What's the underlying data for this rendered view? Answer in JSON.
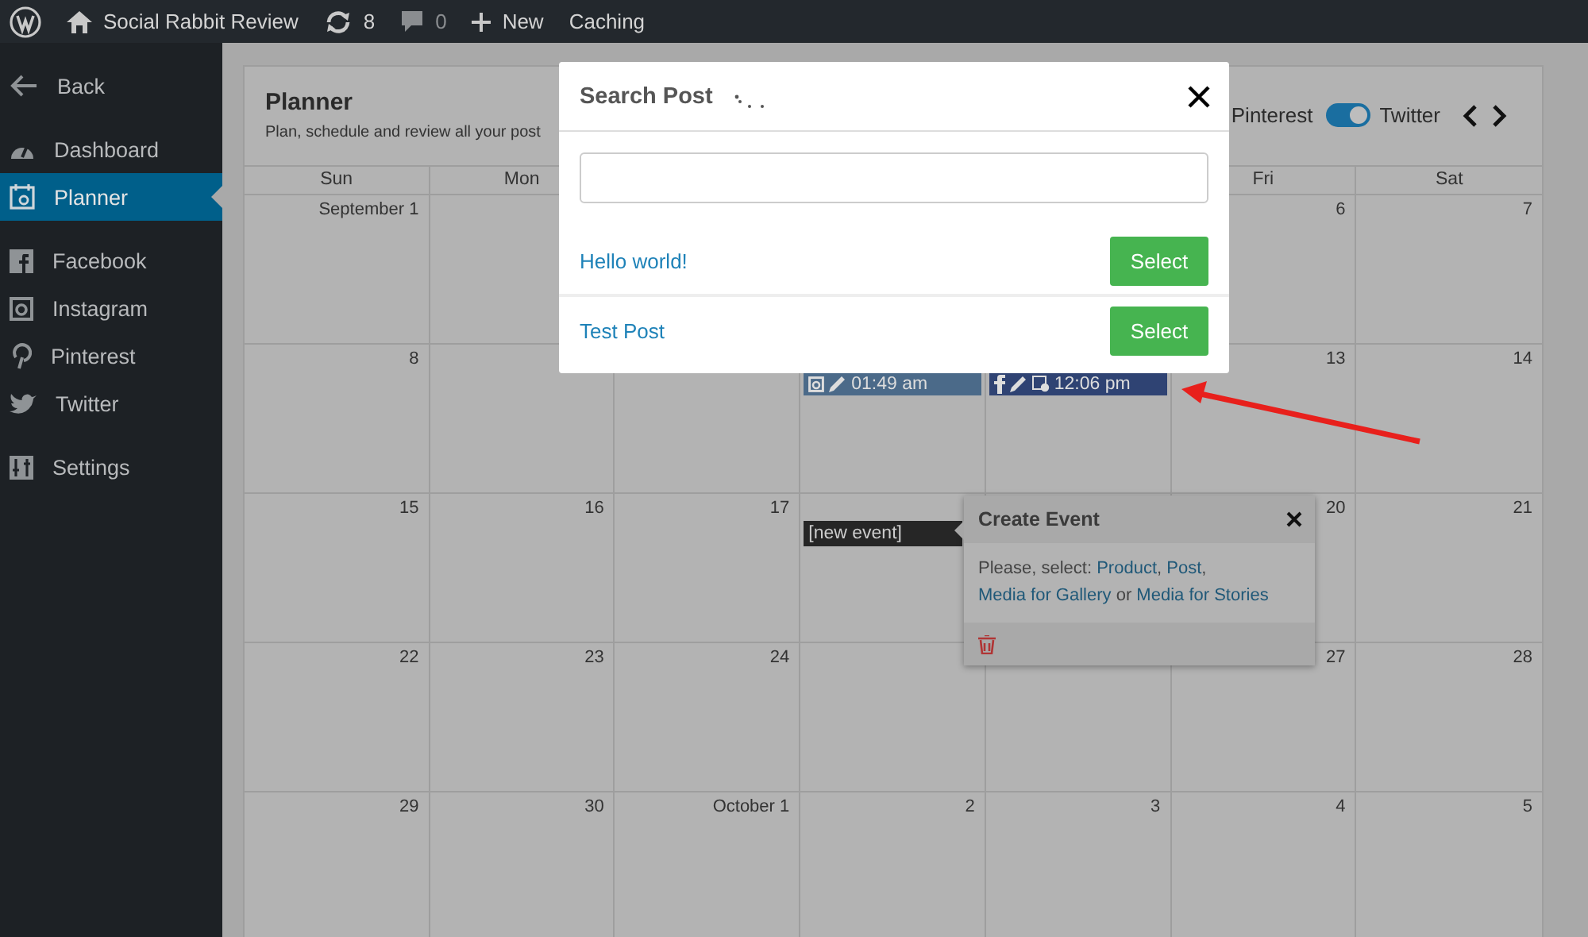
{
  "admin_bar": {
    "site": "Social Rabbit Review",
    "updates": "8",
    "comments": "0",
    "new": "New",
    "caching": "Caching"
  },
  "sidebar": {
    "groups": [
      [
        {
          "label": "Back",
          "kind": "back",
          "selected": false
        }
      ],
      [
        {
          "label": "Dashboard",
          "kind": "dashboard",
          "selected": false
        },
        {
          "label": "Planner",
          "kind": "planner",
          "selected": true
        }
      ],
      [
        {
          "label": "Facebook",
          "kind": "facebook",
          "selected": false
        },
        {
          "label": "Instagram",
          "kind": "instagram",
          "selected": false
        },
        {
          "label": "Pinterest",
          "kind": "pinterest",
          "selected": false
        },
        {
          "label": "Twitter",
          "kind": "twitter",
          "selected": false
        }
      ],
      [
        {
          "label": "Settings",
          "kind": "settings",
          "selected": false
        }
      ]
    ]
  },
  "planner": {
    "title": "Planner",
    "subtitle": "Plan, schedule and review all your post",
    "networks": [
      {
        "label": "Pinterest"
      },
      {
        "label": "Twitter",
        "on": true
      }
    ],
    "weekdays": [
      "Sun",
      "Mon",
      "Fri",
      "Sat"
    ],
    "weeks": [
      [
        {
          "day": "September 1"
        },
        {
          "day": "6"
        },
        {
          "day": "7"
        }
      ],
      [
        {
          "day": "8"
        },
        {
          "events": [
            {
              "kind": "instagram",
              "time": "01:49 am",
              "color": "#4b6a89"
            }
          ]
        },
        {
          "events": [
            {
              "kind": "facebook",
              "time": "12:06 pm",
              "color": "#2f4373"
            }
          ]
        },
        {
          "day": "13"
        },
        {
          "day": "14"
        }
      ],
      [
        {
          "day": "15"
        },
        {
          "day": "16"
        },
        {
          "day": "17"
        },
        {
          "events": [
            {
              "kind": "new",
              "time": "[new event]",
              "color": "#262626"
            }
          ]
        },
        {
          "day": "20"
        },
        {
          "day": "21"
        }
      ],
      [
        {
          "day": "22"
        },
        {
          "day": "23"
        },
        {
          "day": "24"
        },
        {
          "day": "27"
        },
        {
          "day": "28"
        }
      ],
      [
        {
          "day": "29"
        },
        {
          "day": "30"
        },
        {
          "day": "October 1"
        },
        {
          "day": "2"
        },
        {
          "day": "3"
        },
        {
          "day": "4"
        },
        {
          "day": "5"
        }
      ]
    ]
  },
  "search_modal": {
    "title": "Search Post",
    "results": [
      {
        "title": "Hello world!",
        "button": "Select"
      },
      {
        "title": "Test Post",
        "button": "Select"
      }
    ]
  },
  "create_event": {
    "title": "Create Event",
    "message": [
      {
        "kind": "text",
        "text": "Please, select: "
      },
      {
        "kind": "link",
        "text": "Product"
      },
      {
        "kind": "text",
        "text": ", "
      },
      {
        "kind": "link",
        "text": "Post"
      },
      {
        "kind": "text",
        "text": ", "
      },
      {
        "kind": "link",
        "text": "Media for Gallery"
      },
      {
        "kind": "text",
        "text": " or "
      },
      {
        "kind": "link",
        "text": "Media for Stories"
      }
    ]
  }
}
